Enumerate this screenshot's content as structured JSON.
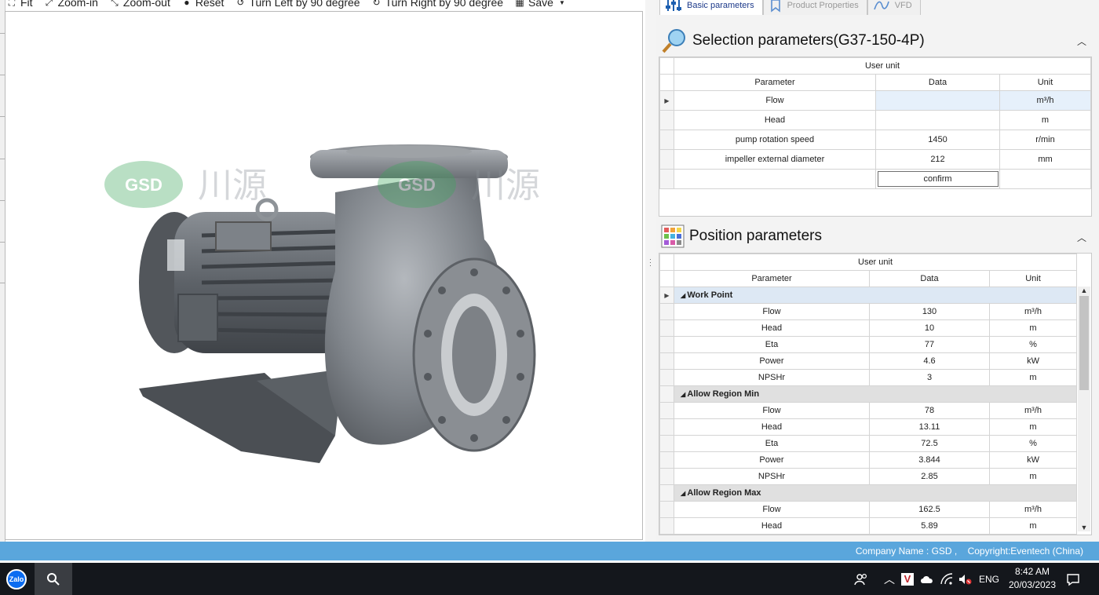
{
  "toolbar": {
    "fit": "Fit",
    "zoom_in": "Zoom-in",
    "zoom_out": "Zoom-out",
    "reset": "Reset",
    "turn_left": "Turn Left by 90 degree",
    "turn_right": "Turn Right by 90 degree",
    "save": "Save"
  },
  "viewer": {
    "watermark_logo": "GSD",
    "watermark_chinese": "川源"
  },
  "tabs": [
    {
      "label": "Basic parameters",
      "active": true
    },
    {
      "label": "Product Properties",
      "active": false
    },
    {
      "label": "VFD",
      "active": false
    }
  ],
  "selection": {
    "title": "Selection parameters(G37-150-4P)",
    "user_unit": "User unit",
    "headers": {
      "parameter": "Parameter",
      "data": "Data",
      "unit": "Unit"
    },
    "rows": [
      {
        "parameter": "Flow",
        "data": "",
        "unit": "m³/h"
      },
      {
        "parameter": "Head",
        "data": "",
        "unit": "m"
      },
      {
        "parameter": "pump rotation speed",
        "data": "1450",
        "unit": "r/min"
      },
      {
        "parameter": "impeller external diameter",
        "data": "212",
        "unit": "mm"
      }
    ],
    "confirm": "confirm"
  },
  "position": {
    "title": "Position parameters",
    "user_unit": "User unit",
    "headers": {
      "parameter": "Parameter",
      "data": "Data",
      "unit": "Unit"
    },
    "groups": [
      {
        "name": "Work Point",
        "rows": [
          {
            "parameter": "Flow",
            "data": "130",
            "unit": "m³/h"
          },
          {
            "parameter": "Head",
            "data": "10",
            "unit": "m"
          },
          {
            "parameter": "Eta",
            "data": "77",
            "unit": "%"
          },
          {
            "parameter": "Power",
            "data": "4.6",
            "unit": "kW"
          },
          {
            "parameter": "NPSHr",
            "data": "3",
            "unit": "m"
          }
        ]
      },
      {
        "name": "Allow Region Min",
        "rows": [
          {
            "parameter": "Flow",
            "data": "78",
            "unit": "m³/h"
          },
          {
            "parameter": "Head",
            "data": "13.11",
            "unit": "m"
          },
          {
            "parameter": "Eta",
            "data": "72.5",
            "unit": "%"
          },
          {
            "parameter": "Power",
            "data": "3.844",
            "unit": "kW"
          },
          {
            "parameter": "NPSHr",
            "data": "2.85",
            "unit": "m"
          }
        ]
      },
      {
        "name": "Allow Region Max",
        "rows": [
          {
            "parameter": "Flow",
            "data": "162.5",
            "unit": "m³/h"
          },
          {
            "parameter": "Head",
            "data": "5.89",
            "unit": "m"
          }
        ]
      }
    ]
  },
  "status": {
    "company": "Company Name : GSD ,",
    "copyright": "Copyright:Eventech (China)"
  },
  "taskbar": {
    "zalo_label": "Zalo",
    "language": "ENG",
    "time": "8:42 AM",
    "date": "20/03/2023"
  },
  "colors": {
    "status_bar": "#5aa6dc",
    "taskbar": "#14171c",
    "selected_cell": "#e6f0fb",
    "pump_gray": "#6b7076"
  }
}
